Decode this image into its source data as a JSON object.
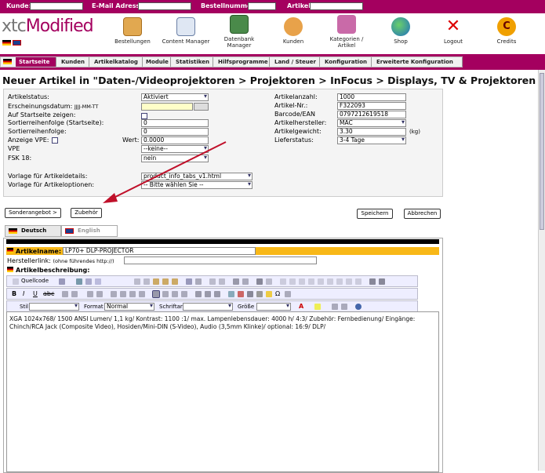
{
  "topbar": {
    "kunde": "Kunde:",
    "email": "E-Mail Adresse:",
    "bestellnummer": "Bestellnummer:",
    "artikel": "Artikel:"
  },
  "logo": {
    "left": "xtc",
    "right": "Modified"
  },
  "nav": {
    "bestellungen": "Bestellungen",
    "content_manager": "Content Manager",
    "datenbank": "Datenbank Manager",
    "kunden": "Kunden",
    "kategorien": "Kategorien / Artikel",
    "shop": "Shop",
    "logout": "Logout",
    "credits": "Credits"
  },
  "tabs": {
    "startseite": "Startseite",
    "kunden": "Kunden",
    "artikelkatalog": "Artikelkatalog",
    "module": "Module",
    "statistiken": "Statistiken",
    "hilfsprogramme": "Hilfsprogramme",
    "land_steuer": "Land / Steuer",
    "konfiguration": "Konfiguration",
    "erweitert": "Erweiterte Konfiguration"
  },
  "page": {
    "title": "Neuer Artikel in \"Daten-/Videoprojektoren > Projektoren > InFocus > Displays, TV & Projektoren"
  },
  "form": {
    "artikelstatus_label": "Artikelstatus:",
    "artikelstatus_value": "Aktiviert",
    "erscheinung_label": "Erscheinungsdatum:",
    "erscheinung_hint": "JJJJ-MM-TT",
    "startseite_label": "Auf Startseite zeigen:",
    "sort_start_label": "Sortierreihenfolge (Startseite):",
    "sort_start_value": "0",
    "sort_label": "Sortierreihenfolge:",
    "sort_value": "0",
    "vpe_anzeige_label": "Anzeige VPE:",
    "wert_label": "Wert:",
    "wert_value": "0.0000",
    "vpe_label": "VPE",
    "vpe_value": "--keine--",
    "fsk_label": "FSK 18:",
    "fsk_value": "nein",
    "vorlage_details_label": "Vorlage für Artikeldetails:",
    "vorlage_details_value": "product_info_tabs_v1.html",
    "vorlage_optionen_label": "Vorlage für Artikeloptionen:",
    "vorlage_optionen_value": "-- Bitte wählen Sie --",
    "anzahl_label": "Artikelanzahl:",
    "anzahl_value": "1000",
    "nr_label": "Artikel-Nr.:",
    "nr_value": "F322093",
    "ean_label": "Barcode/EAN",
    "ean_value": "0797212619518",
    "hersteller_label": "Artikelhersteller:",
    "hersteller_value": "MAC",
    "gewicht_label": "Artikelgewicht:",
    "gewicht_value": "3.30",
    "gewicht_unit": "(kg)",
    "lieferstatus_label": "Lieferstatus:",
    "lieferstatus_value": "3-4 Tage"
  },
  "buttons": {
    "sonderangebot": "Sonderangebot >",
    "zubehoer": "Zubehör",
    "speichern": "Speichern",
    "abbrechen": "Abbrechen"
  },
  "lang": {
    "deutsch": "Deutsch",
    "english": "English"
  },
  "editor": {
    "artikelname_label": "Artikelname:",
    "artikelname_value": "LP70+ DLP-PROJECTOR",
    "herstellerlink_label": "Herstellerlink:",
    "herstellerlink_hint": "(ohne führendes http://)",
    "beschreibung_label": "Artikelbeschreibung:",
    "quellcode": "Quellcode",
    "stil": "Stil",
    "format": "Format",
    "format_value": "Normal",
    "schriftart": "Schriftart",
    "groesse": "Größe",
    "body": "XGA 1024x768/ 1500 ANSI Lumen/ 1,1 kg/ Kontrast: 1100 :1/ max. Lampenlebensdauer: 4000 h/ 4:3/ Zubehör: Fernbedienung/ Eingänge: Chinch/RCA Jack (Composite Video), Hosiden/Mini-DIN (S-Video), Audio (3,5mm Klinke)/ optional: 16:9/ DLP/"
  },
  "colors": {
    "brand": "#a4005f",
    "name_bar": "#f8b818",
    "arrow": "#c0102a"
  }
}
